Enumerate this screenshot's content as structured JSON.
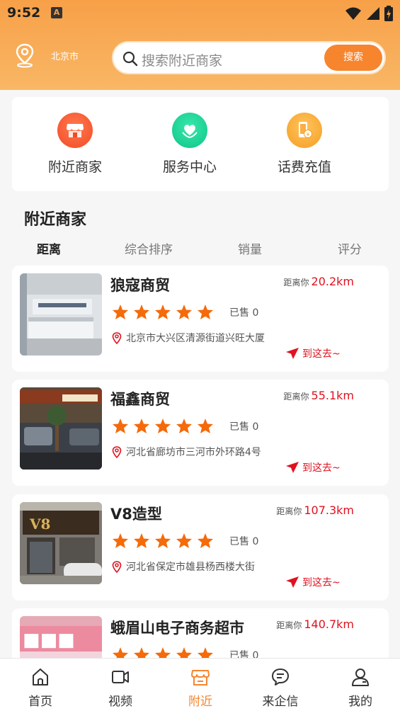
{
  "status_bar": {
    "time": "9:52",
    "notif_badge": "A"
  },
  "header": {
    "location": "北京市",
    "search_placeholder": "搜索附近商家",
    "search_button": "搜索"
  },
  "quick_actions": [
    {
      "label": "附近商家",
      "icon": "store-icon",
      "color": "#f5603a"
    },
    {
      "label": "服务中心",
      "icon": "heart-hand-icon",
      "color": "#1fd29a"
    },
    {
      "label": "话费充值",
      "icon": "phone-recharge-icon",
      "color": "#f8a93a"
    }
  ],
  "section_title": "附近商家",
  "sort_tabs": [
    "距离",
    "综合排序",
    "销量",
    "评分"
  ],
  "dist_prefix": "距离你",
  "go_label": "到这去~",
  "merchants": [
    {
      "name": "狼寇商贸",
      "distance": "20.2km",
      "sold": "已售 0",
      "rating": 5,
      "address": "北京市大兴区清源街道兴旺大厦"
    },
    {
      "name": "福鑫商贸",
      "distance": "55.1km",
      "sold": "已售 0",
      "rating": 5,
      "address": "河北省廊坊市三河市外环路4号"
    },
    {
      "name": "V8造型",
      "distance": "107.3km",
      "sold": "已售 0",
      "rating": 5,
      "address": "河北省保定市雄县杨西楼大街"
    },
    {
      "name": "蛾眉山电子商务超市",
      "distance": "140.7km",
      "sold": "已售 0",
      "rating": 5,
      "address": ""
    }
  ],
  "tab_bar": [
    {
      "label": "首页",
      "icon": "home-icon"
    },
    {
      "label": "视频",
      "icon": "video-icon"
    },
    {
      "label": "附近",
      "icon": "store-icon"
    },
    {
      "label": "来企信",
      "icon": "chat-icon"
    },
    {
      "label": "我的",
      "icon": "user-icon"
    }
  ],
  "colors": {
    "accent": "#f7852e",
    "distance_red": "#e0121f",
    "star": "#f56a0a"
  }
}
